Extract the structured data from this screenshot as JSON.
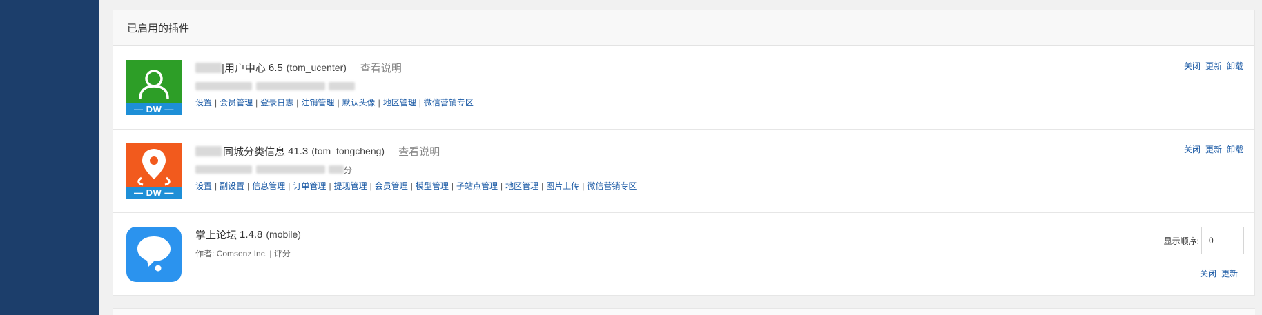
{
  "panel": {
    "title": "已启用的插件"
  },
  "colors": {
    "sidebar": "#1c3e6b",
    "link": "#1b5aa5",
    "dw_bar": "#1e8fd7",
    "green_icon": "#2d9e27",
    "orange_icon": "#f25a1d",
    "blue_icon": "#2b93ee"
  },
  "plugins": [
    {
      "icon": "user-icon",
      "badge": "— DW —",
      "name": "|用户中心",
      "version": "6.5",
      "id": "(tom_ucenter)",
      "doc_link": "查看说明",
      "meta_suffix": "",
      "links": [
        "设置",
        "会员管理",
        "登录日志",
        "注销管理",
        "默认头像",
        "地区管理",
        "微信营销专区"
      ],
      "actions": [
        "关闭",
        "更新",
        "卸载"
      ]
    },
    {
      "icon": "map-pin-icon",
      "badge": "— DW —",
      "name": "同城分类信息",
      "version": "41.3",
      "id": "(tom_tongcheng)",
      "doc_link": "查看说明",
      "meta_suffix": "分",
      "links": [
        "设置",
        "副设置",
        "信息管理",
        "订单管理",
        "提现管理",
        "会员管理",
        "模型管理",
        "子站点管理",
        "地区管理",
        "图片上传",
        "微信营销专区"
      ],
      "actions": [
        "关闭",
        "更新",
        "卸载"
      ]
    },
    {
      "icon": "chat-bubble-icon",
      "name": "掌上论坛",
      "version": "1.4.8",
      "id": "(mobile)",
      "meta": "作者: Comsenz Inc. | 评分",
      "order_label": "显示顺序:",
      "order_value": "0",
      "actions": [
        "关闭",
        "更新"
      ]
    }
  ]
}
